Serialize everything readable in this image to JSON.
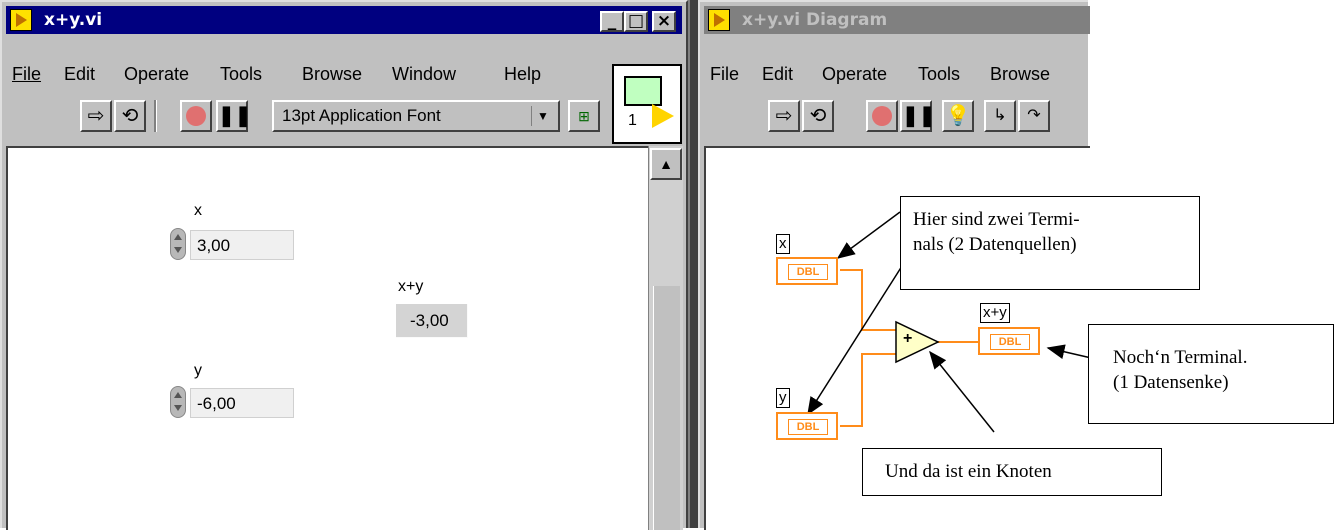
{
  "front_panel": {
    "title": "x+y.vi",
    "menu": [
      "File",
      "Edit",
      "Operate",
      "Tools",
      "Browse",
      "Window",
      "Help"
    ],
    "font_select": "13pt Application Font",
    "vi_icon_label": "1",
    "controls": [
      {
        "label": "x",
        "value": "3,00"
      },
      {
        "label": "y",
        "value": "-6,00"
      }
    ],
    "indicator": {
      "label": "x+y",
      "value": "-3,00"
    }
  },
  "diagram": {
    "title": "x+y.vi Diagram",
    "menu": [
      "File",
      "Edit",
      "Operate",
      "Tools",
      "Browse"
    ],
    "terminals": [
      {
        "label": "x",
        "type": "DBL"
      },
      {
        "label": "y",
        "type": "DBL"
      },
      {
        "label": "x+y",
        "type": "DBL"
      }
    ],
    "node_symbol": "+",
    "callouts": {
      "terminals": "Hier sind zwei Termi-nals (2 Datenquellen)",
      "terminals_line1": "Hier sind zwei Termi-",
      "terminals_line2": "nals (2 Datenquellen)",
      "sink_line1": "Noch‘n Terminal.",
      "sink_line2": "(1 Datensenke)",
      "node": "Und da ist ein Knoten"
    }
  },
  "colors": {
    "title_active": "#000080",
    "title_inactive": "#808080",
    "wire": "#ff8c1a",
    "node_fill": "#ffffc8"
  }
}
